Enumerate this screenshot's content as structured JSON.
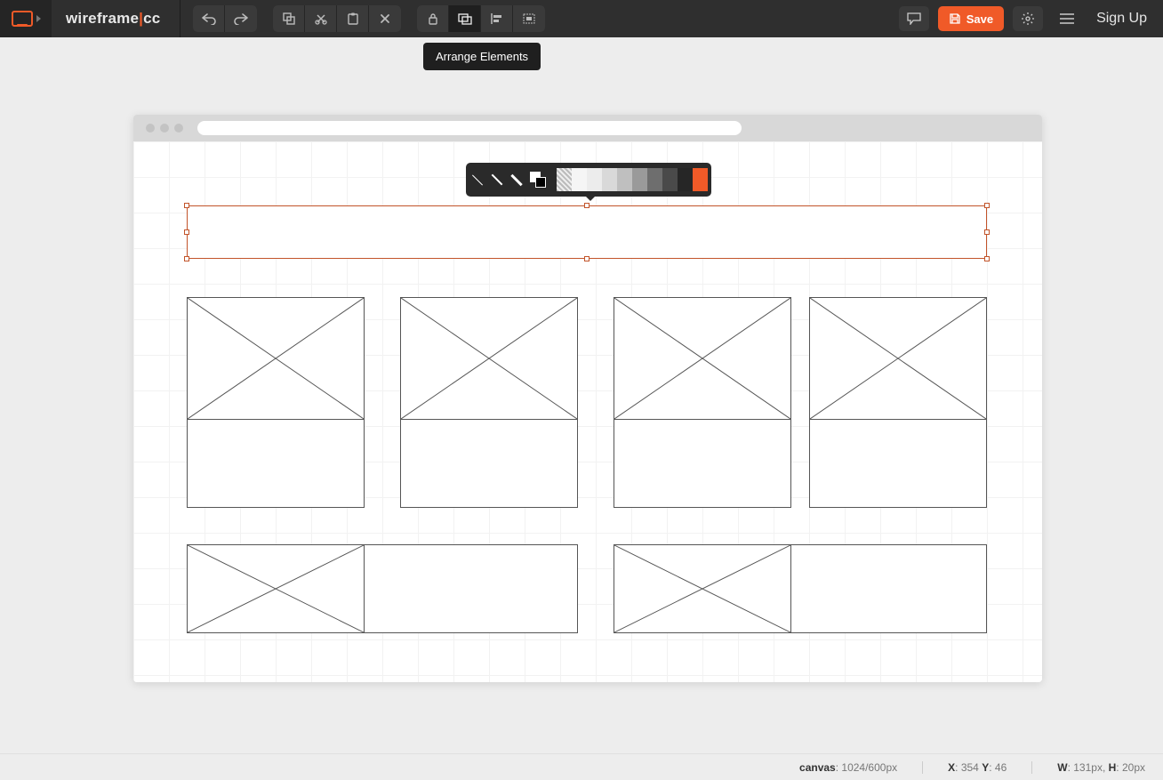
{
  "brand": {
    "left": "wireframe",
    "right": "cc"
  },
  "tooltip": "Arrange Elements",
  "save_label": "Save",
  "signup_label": "Sign Up",
  "swatches": [
    "url('data:')",
    "#f5f5f5",
    "#ececec",
    "#d9d9d9",
    "#bfbfbf",
    "#9a9a9a",
    "#6e6e6e",
    "#4a4a4a",
    "#262626",
    "#f05a28"
  ],
  "hatch_swatch_index": 0,
  "status": {
    "canvas_label": "canvas",
    "canvas_value": "1024/600px",
    "x_label": "X",
    "x_value": "354",
    "y_label": "Y",
    "y_value": "46",
    "w_label": "W",
    "w_value": "131px",
    "h_label": "H",
    "h_value": "20px"
  }
}
